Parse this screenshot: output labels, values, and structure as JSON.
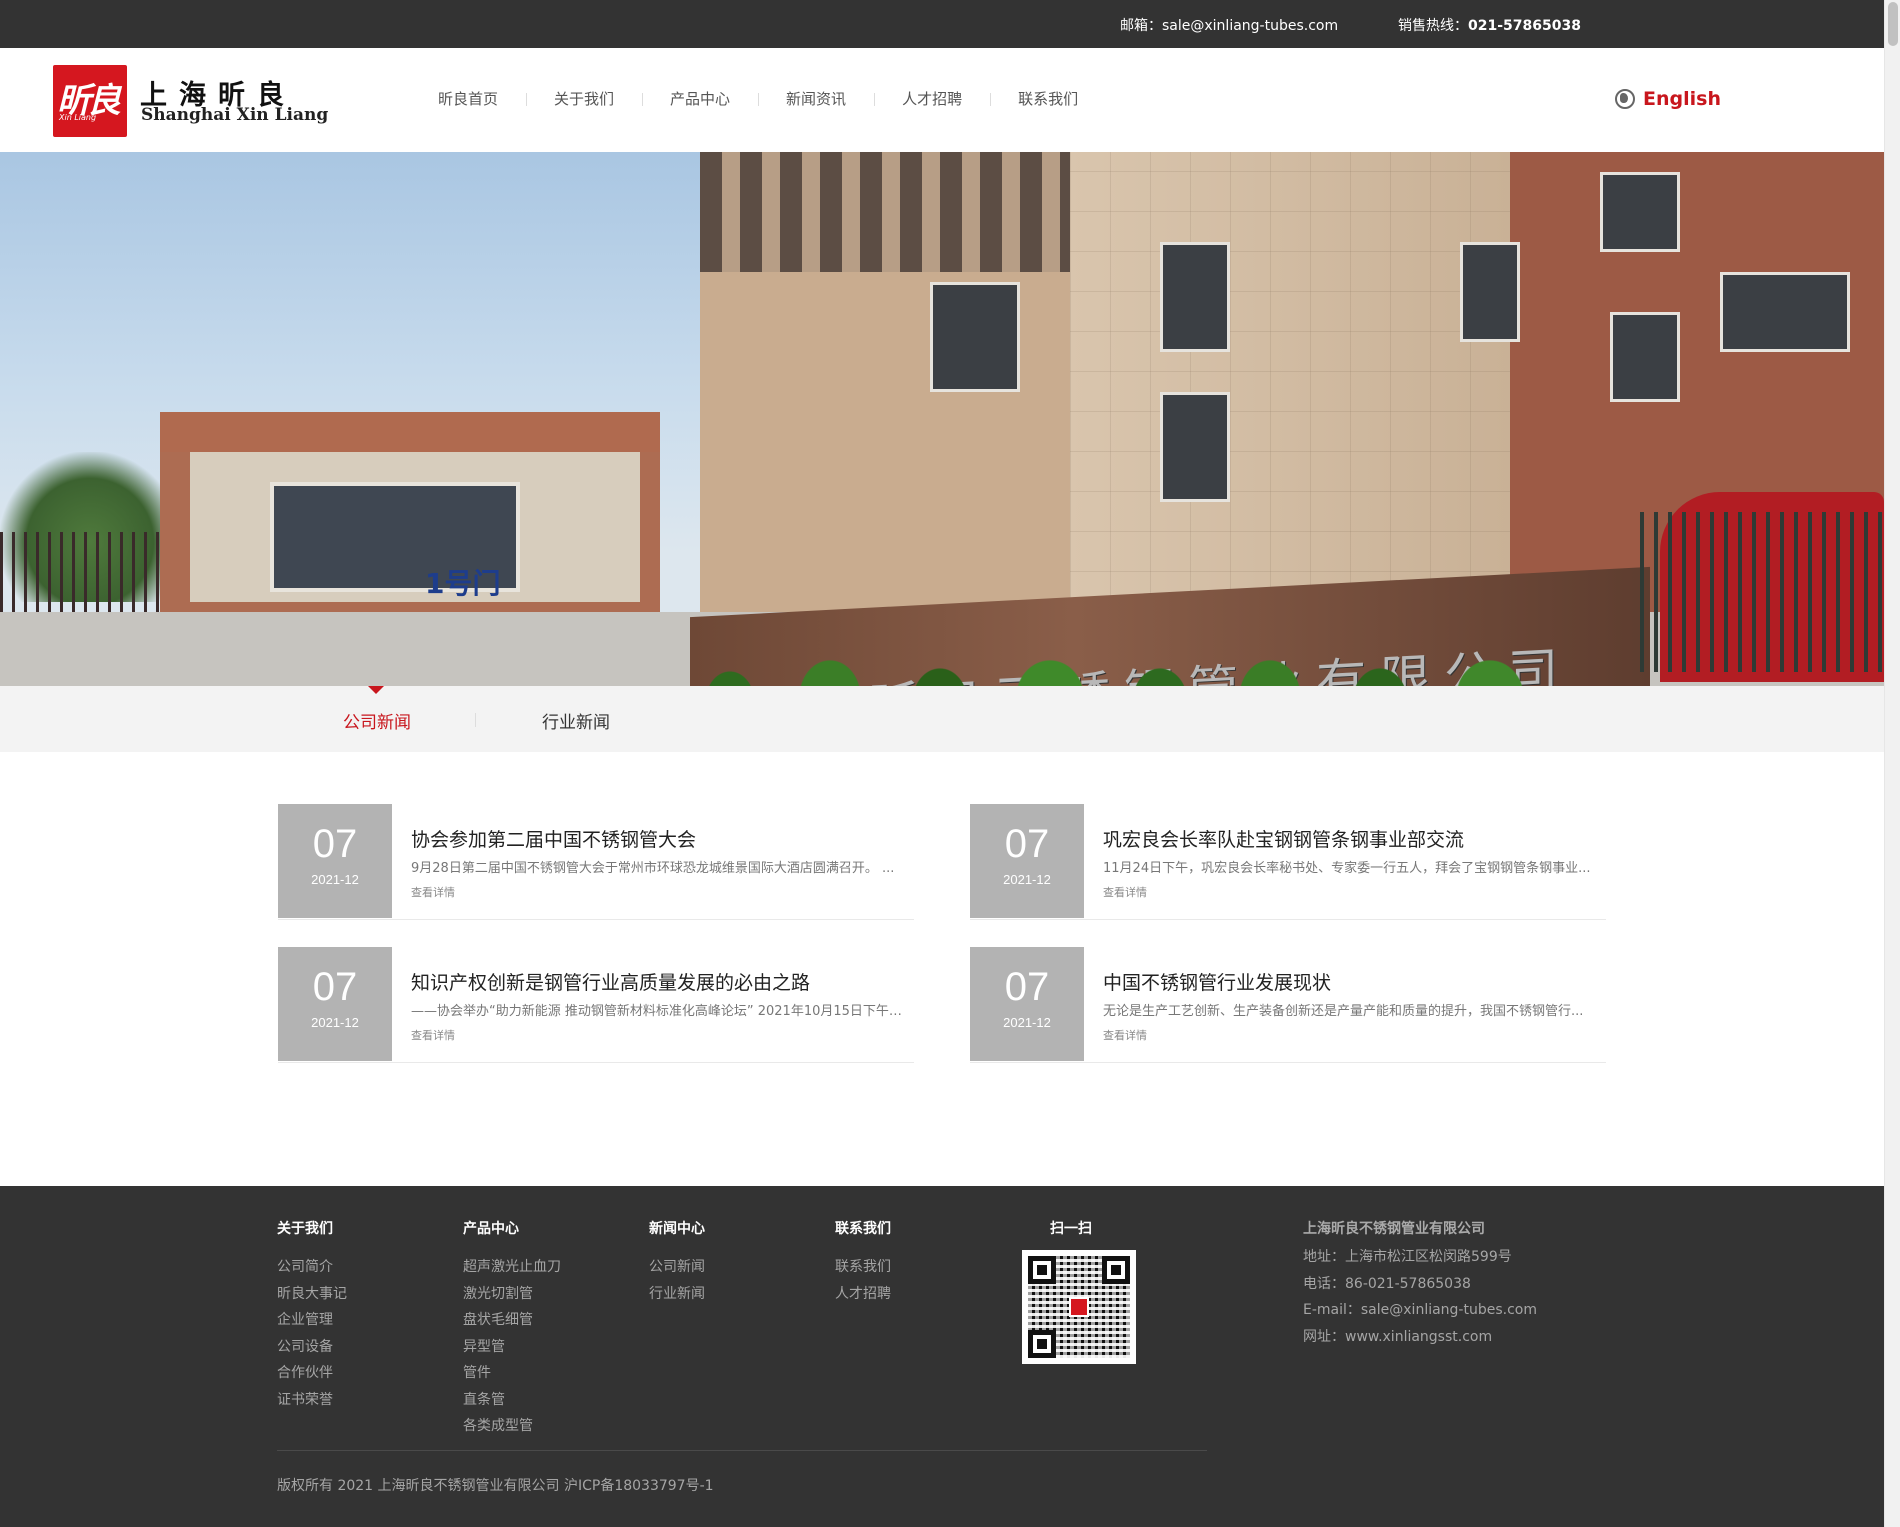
{
  "topbar": {
    "email": "邮箱：sale@xinliang-tubes.com",
    "hotline_label": "销售热线：",
    "hotline_number": "021-57865038"
  },
  "header": {
    "logo_mark": "昕良",
    "logo_mark_small": "Xin Liang",
    "logo_cn": "上海昕良",
    "logo_en": "Shanghai Xin Liang",
    "nav": [
      "昕良首页",
      "关于我们",
      "产品中心",
      "新闻资讯",
      "人才招聘",
      "联系我们"
    ],
    "language": "English",
    "language_icon": "globe-icon"
  },
  "hero": {
    "gate_number": "1号门",
    "wall_text": "上海昕良不锈钢管业有限公司"
  },
  "tabs": {
    "items": [
      "公司新闻",
      "行业新闻"
    ],
    "active_index": 0,
    "accent_color": "#c8161d"
  },
  "news": [
    {
      "day": "07",
      "month": "2021-12",
      "title": "协会参加第二届中国不锈钢管大会",
      "summary": "9月28日第二届中国不锈钢管大会于常州市环球恐龙城维景国际大酒店圆满召开。 ...",
      "more": "查看详情"
    },
    {
      "day": "07",
      "month": "2021-12",
      "title": "巩宏良会长率队赴宝钢钢管条钢事业部交流",
      "summary": "11月24日下午，巩宏良会长率秘书处、专家委一行五人，拜会了宝钢钢管条钢事业...",
      "more": "查看详情"
    },
    {
      "day": "07",
      "month": "2021-12",
      "title": "知识产权创新是钢管行业高质量发展的必由之路",
      "summary": "——协会举办“助力新能源 推动钢管新材料标准化高峰论坛” 2021年10月15日下午，...",
      "more": "查看详情"
    },
    {
      "day": "07",
      "month": "2021-12",
      "title": "中国不锈钢管行业发展现状",
      "summary": "无论是生产工艺创新、生产装备创新还是产量产能和质量的提升，我国不锈钢管行...",
      "more": "查看详情"
    }
  ],
  "footer": {
    "columns": [
      {
        "heading": "关于我们",
        "links": [
          "公司简介",
          "昕良大事记",
          "企业管理",
          "公司设备",
          "合作伙伴",
          "证书荣誉"
        ]
      },
      {
        "heading": "产品中心",
        "links": [
          "超声激光止血刀",
          "激光切割管",
          "盘状毛细管",
          "异型管",
          "管件",
          "直条管",
          "各类成型管"
        ]
      },
      {
        "heading": "新闻中心",
        "links": [
          "公司新闻",
          "行业新闻"
        ]
      },
      {
        "heading": "联系我们",
        "links": [
          "联系我们",
          "人才招聘"
        ]
      }
    ],
    "scan_label": "扫一扫",
    "company": "上海昕良不锈钢管业有限公司",
    "address": "地址：上海市松江区松闵路599号",
    "phone": "电话：86-021-57865038",
    "email": "E-mail：sale@xinliang-tubes.com",
    "website": "网址：www.xinliangsst.com",
    "copyright": "版权所有 2021 上海昕良不锈钢管业有限公司 沪ICP备18033797号-1"
  }
}
